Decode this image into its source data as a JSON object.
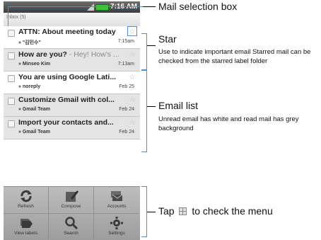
{
  "status_bar": {
    "time": "7:16 AM"
  },
  "inbox_header": {
    "title": "Inbox (5)",
    "account": ""
  },
  "emails": [
    {
      "subject": "ATTN: About meeting today",
      "snippet": "",
      "sender": "» \"김민수\"",
      "date": "7:15am",
      "state": "unread",
      "starred": false
    },
    {
      "subject": "How are you?",
      "snippet": " - Hey! How's ...",
      "sender": "» Minseo Kim",
      "date": "7:13am",
      "state": "read",
      "starred": false
    },
    {
      "subject": "You are using Google Lati...",
      "snippet": "",
      "sender": "» noreply",
      "date": "Feb 25",
      "state": "unread",
      "starred": false
    },
    {
      "subject": "Customize Gmail with col...",
      "snippet": "",
      "sender": "» Gmail Team",
      "date": "Feb 24",
      "state": "read",
      "starred": false
    },
    {
      "subject": "Import your contacts and...",
      "snippet": "",
      "sender": "» Gmail Team",
      "date": "Feb 24",
      "state": "read",
      "starred": false
    }
  ],
  "menu": [
    {
      "label": "Refresh",
      "icon": "refresh-icon"
    },
    {
      "label": "Compose",
      "icon": "compose-icon"
    },
    {
      "label": "Accounts",
      "icon": "accounts-icon"
    },
    {
      "label": "View labels",
      "icon": "labels-icon"
    },
    {
      "label": "Search",
      "icon": "search-icon"
    },
    {
      "label": "Settings",
      "icon": "settings-icon"
    }
  ],
  "annotations": {
    "mail_selection_box": "Mail selection box",
    "star_title": "Star",
    "star_desc": "Use to indicate important email Starred mail can be checked from the starred label folder",
    "email_list_title": "Email list",
    "email_list_desc": "Unread email has white and read mail has grey background",
    "menu_tap_prefix": "Tap",
    "menu_tap_suffix": "to check the menu"
  },
  "colors": {
    "callout_blue": "#4a8fd4",
    "read_bg": "#e4e4e4",
    "unread_bg": "#ffffff",
    "menu_bg": "#a8a8a8"
  }
}
